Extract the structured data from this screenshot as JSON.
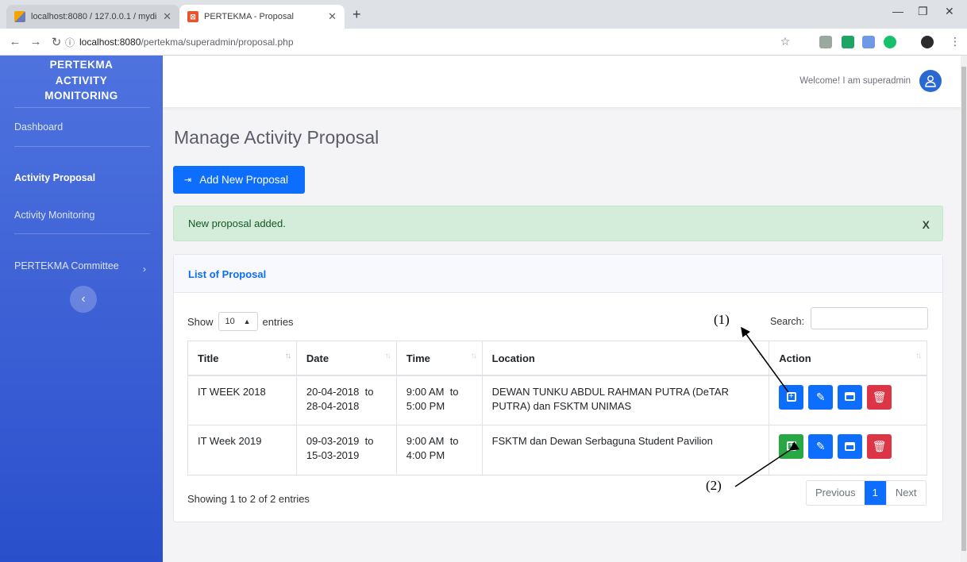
{
  "browser": {
    "tabs": [
      {
        "title": "localhost:8080 / 127.0.0.1 / mydi"
      },
      {
        "title": "PERTEKMA - Proposal"
      }
    ],
    "new_tab": "+",
    "url_host": "localhost:8080",
    "url_path": "/pertekma/superadmin/proposal.php"
  },
  "sidebar": {
    "brand_line1": "PERTEKMA",
    "brand_line2": "ACTIVITY",
    "brand_line3": "MONITORING",
    "items": [
      {
        "label": "Dashboard"
      },
      {
        "label": "Activity Proposal"
      },
      {
        "label": "Activity Monitoring"
      },
      {
        "label": "PERTEKMA Committee"
      }
    ],
    "toggle": "‹"
  },
  "topbar": {
    "welcome": "Welcome! I am superadmin"
  },
  "main": {
    "title": "Manage Activity Proposal",
    "add_button": "Add New Proposal",
    "alert": {
      "message": "New proposal added.",
      "close": "X"
    },
    "card_title": "List of Proposal",
    "show_label": "Show",
    "entries_value": "10",
    "entries_label": "entries",
    "search_label": "Search:",
    "columns": [
      "Title",
      "Date",
      "Time",
      "Location",
      "Action"
    ],
    "rows": [
      {
        "title": "IT WEEK 2018",
        "date_from": "20-04-2018",
        "date_to": "28-04-2018",
        "time_from": "9:00 AM",
        "time_to": "5:00 PM",
        "location": "DEWAN TUNKU ABDUL RAHMAN PUTRA (DeTAR PUTRA) dan FSKTM UNIMAS"
      },
      {
        "title": "IT Week 2019",
        "date_from": "09-03-2019",
        "date_to": "15-03-2019",
        "time_from": "9:00 AM",
        "time_to": "4:00 PM",
        "location": "FSKTM dan Dewan Serbaguna Student Pavilion"
      }
    ],
    "to_word": "to",
    "showing_text": "Showing 1 to 2 of 2 entries",
    "pagination": {
      "previous": "Previous",
      "current": "1",
      "next": "Next"
    }
  },
  "annotations": {
    "label1": "(1)",
    "label2": "(2)"
  },
  "colors": {
    "primary": "#0d6efd",
    "success": "#28a745",
    "danger": "#dc3545",
    "alert_bg": "#d4edda",
    "sidebar": "#4e73df"
  }
}
